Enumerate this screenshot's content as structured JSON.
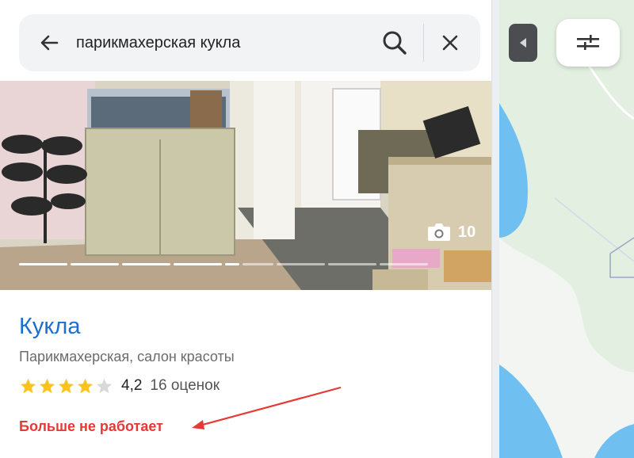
{
  "search": {
    "query": "парикмахерская кукла"
  },
  "photo": {
    "count": "10"
  },
  "org": {
    "name": "Кукла",
    "category": "Парикмахерская, салон красоты",
    "rating": "4,2",
    "rating_stars": 4.2,
    "reviews": "16 оценок",
    "status": "Больше не работает"
  },
  "colors": {
    "name_link": "#1a6fd1",
    "status_closed": "#e53935",
    "star": "#fcc419",
    "annotation_arrow": "#e53935"
  },
  "icons": {
    "back": "arrow-left-icon",
    "search": "magnifier-icon",
    "close": "close-icon",
    "camera": "camera-icon",
    "collapse": "triangle-left-icon",
    "filter": "sliders-icon"
  }
}
